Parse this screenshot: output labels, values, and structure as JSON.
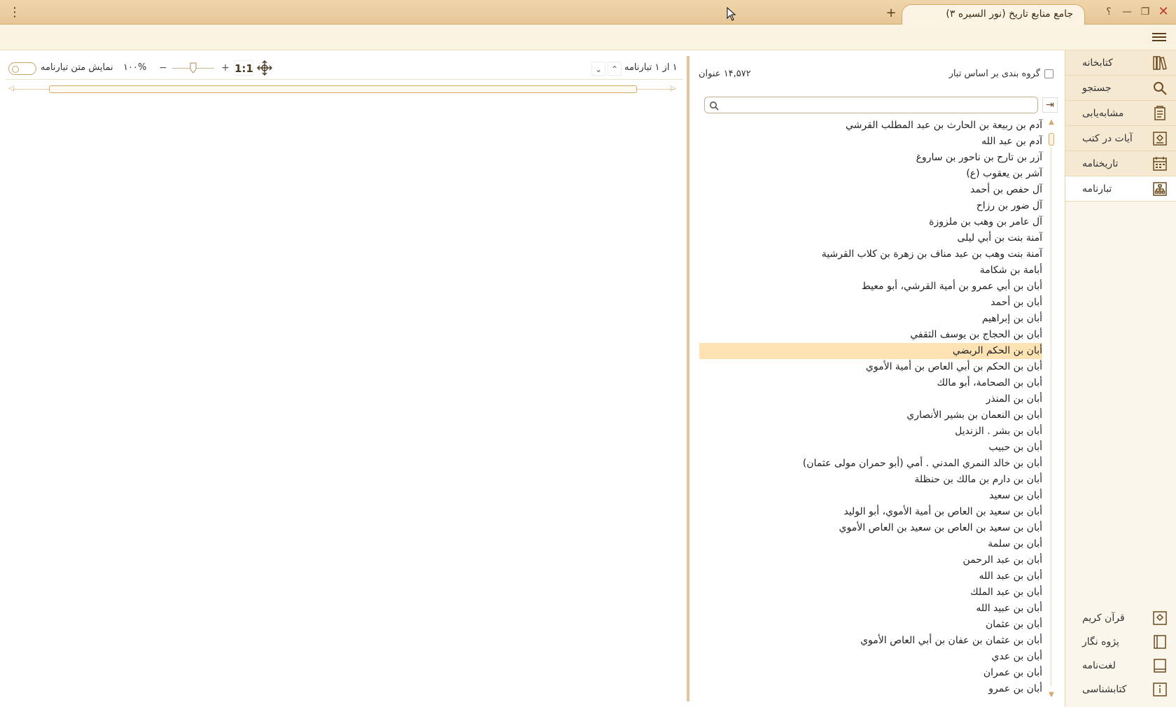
{
  "titlebar": {
    "tab_title": "جامع منابع تاریخ (نور السيره ۳)",
    "new_tab": "+",
    "menu_glyph": "⋮",
    "help": "؟",
    "minimize": "—",
    "restore": "❐",
    "close": "✕"
  },
  "sidebar": {
    "items": [
      {
        "label": "کتابخانه",
        "icon": "books-icon"
      },
      {
        "label": "جستجو",
        "icon": "search-icon"
      },
      {
        "label": "مشابه‌یابی",
        "icon": "similarity-icon"
      },
      {
        "label": "آیات در کتب",
        "icon": "verses-icon"
      },
      {
        "label": "تاریخنامه",
        "icon": "calendar-icon"
      },
      {
        "label": "تبارنامه",
        "icon": "family-tree-icon"
      }
    ],
    "bottom_items": [
      {
        "label": "قرآن کریم",
        "icon": "quran-icon"
      },
      {
        "label": "پژوه نگار",
        "icon": "notebook-icon"
      },
      {
        "label": "لغت‌نامه",
        "icon": "dictionary-icon"
      },
      {
        "label": "کتابشناسی",
        "icon": "info-icon"
      }
    ]
  },
  "list": {
    "group_label": "گروه بندی بر اساس تبار",
    "count": "۱۴,۵۷۲ عنوان",
    "search_placeholder": "",
    "names": [
      "آدم بن ربيعة بن الحارث بن عبد المطلب القرشي",
      "آدم بن عبد الله",
      "آزر بن تارح بن ناحور بن ساروغ",
      "آشر بن يعقوب (ع)",
      "آل حفص بن أحمد",
      "آل ضور بن رزاح",
      "آل عامر بن وهب بن ملزوزة",
      "آمنة بنت بن أبي ليلى",
      "آمنة بنت وهب بن عبد مناف بن زهرة بن كلاب القرشية",
      "أبامة بن شكامة",
      "أبان بن أبي عمرو بن أمية القرشي، أبو معيط",
      "أبان بن أحمد",
      "أبان بن إبراهيم",
      "أبان بن الحجاج بن يوسف الثقفي",
      "أبان بن الحكم الربضي",
      "أبان بن الحكم بن أبي العاص بن أمية الأموي",
      "أبان بن الصحامة، أبو مالك",
      "أبان بن المنذر",
      "أبان بن النعمان بن بشير الأنصاري",
      "أبان بن بشر . الزنديل",
      "أبان بن حبيب",
      "أبان بن خالد النمري المدني . أمي (أبو حمران مولى عثمان)",
      "أبان بن دارم بن مالك بن حنظلة",
      "أبان بن سعيد",
      "أبان بن سعيد بن العاص بن أمية الأموي، أبو الوليد",
      "أبان بن سعيد بن العاص بن سعيد بن العاص الأموي",
      "أبان بن سلمة",
      "أبان بن عبد الرحمن",
      "أبان بن عبد الله",
      "أبان بن عبد الملك",
      "أبان بن عبيد الله",
      "أبان بن عثمان",
      "أبان بن عثمان بن عفان بن أبي العاص الأموي",
      "أبان بن عدي",
      "أبان بن عمران",
      "أبان بن عمرو"
    ],
    "selected_index": 14
  },
  "viewer": {
    "toggle_label": "نمایش متن تبارنامه",
    "zoom": "۱۰۰%",
    "zoom_minus": "−",
    "zoom_plus": "+",
    "one_to_one": "1:1",
    "page_info": "۱ از ۱ تبارنامه",
    "nav_up": "⌃",
    "nav_down": "⌄",
    "zoom_level": 0.5
  },
  "colors": {
    "accent": "#d4a868",
    "selection": "#fde3b4",
    "titlebar": "#ecd0a6"
  }
}
